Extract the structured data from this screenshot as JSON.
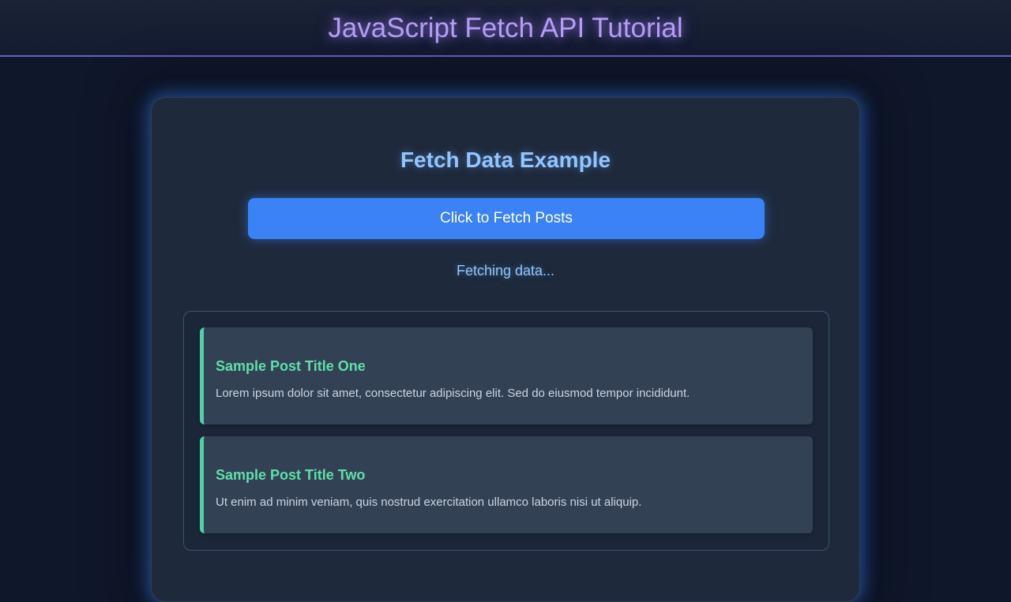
{
  "header": {
    "title": "JavaScript Fetch API Tutorial"
  },
  "card": {
    "title": "Fetch Data Example",
    "button_label": "Click to Fetch Posts",
    "status": "Fetching data..."
  },
  "posts": [
    {
      "title": "Sample Post Title One",
      "body": "Lorem ipsum dolor sit amet, consectetur adipiscing elit. Sed do eiusmod tempor incididunt."
    },
    {
      "title": "Sample Post Title Two",
      "body": "Ut enim ad minim veniam, quis nostrud exercitation ullamco laboris nisi ut aliquip."
    }
  ],
  "colors": {
    "background": "#0f172a",
    "header_accent": "#b79df5",
    "header_border": "#6d5fc9",
    "card_background": "#1e293b",
    "card_title": "#93c5fd",
    "button": "#3b82f6",
    "post_background": "#334155",
    "post_accent": "#4fd1a5",
    "post_title": "#5ee0a8",
    "post_body": "#cbd5e1"
  }
}
